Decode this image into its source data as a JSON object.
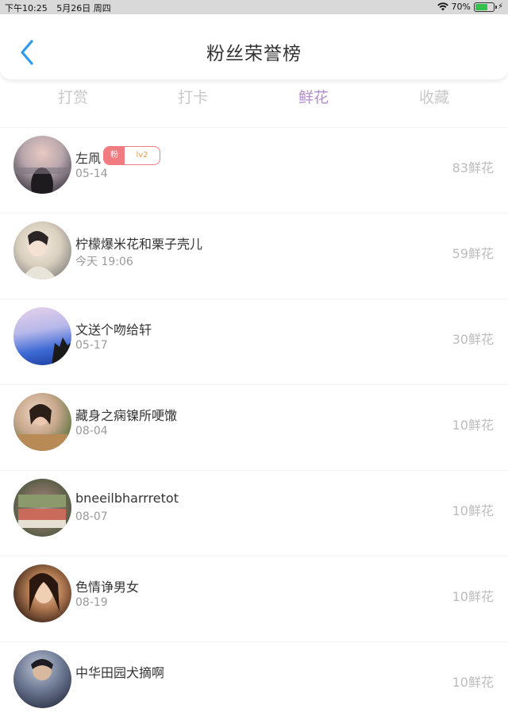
{
  "status_bar": {
    "time": "下午10:25",
    "date": "5月26日 周四",
    "battery": "70%",
    "battery_level": 0.7,
    "icons": [
      "wifi-icon",
      "battery-icon",
      "charging-icon"
    ]
  },
  "header": {
    "title": "粉丝荣誉榜",
    "back_icon": "chevron-left-icon"
  },
  "tabs": [
    {
      "label": "打赏",
      "active": false
    },
    {
      "label": "打卡",
      "active": false
    },
    {
      "label": "鲜花",
      "active": true
    },
    {
      "label": "收藏",
      "active": false
    }
  ],
  "colors": {
    "accent": "#b68ad4",
    "back_arrow": "#2f9bf0",
    "badge": "#f07b80"
  },
  "fans": [
    {
      "name": "左凧",
      "date": "05-14",
      "amount": "83鲜花",
      "badge": {
        "fan": "粉",
        "level": "lv2"
      }
    },
    {
      "name": "柠檬爆米花和栗子壳儿",
      "date": "今天 19:06",
      "amount": "59鲜花"
    },
    {
      "name": "文送个吻给轩",
      "date": "05-17",
      "amount": "30鲜花"
    },
    {
      "name": "藏身之痫镍所哽馓",
      "date": "08-04",
      "amount": "10鲜花"
    },
    {
      "name": "bneeilbharrretot",
      "date": "08-07",
      "amount": "10鲜花"
    },
    {
      "name": "色情诤男女",
      "date": "08-19",
      "amount": "10鲜花"
    },
    {
      "name": "中华田园犬摘啊",
      "date": "",
      "amount": "10鲜花"
    }
  ]
}
